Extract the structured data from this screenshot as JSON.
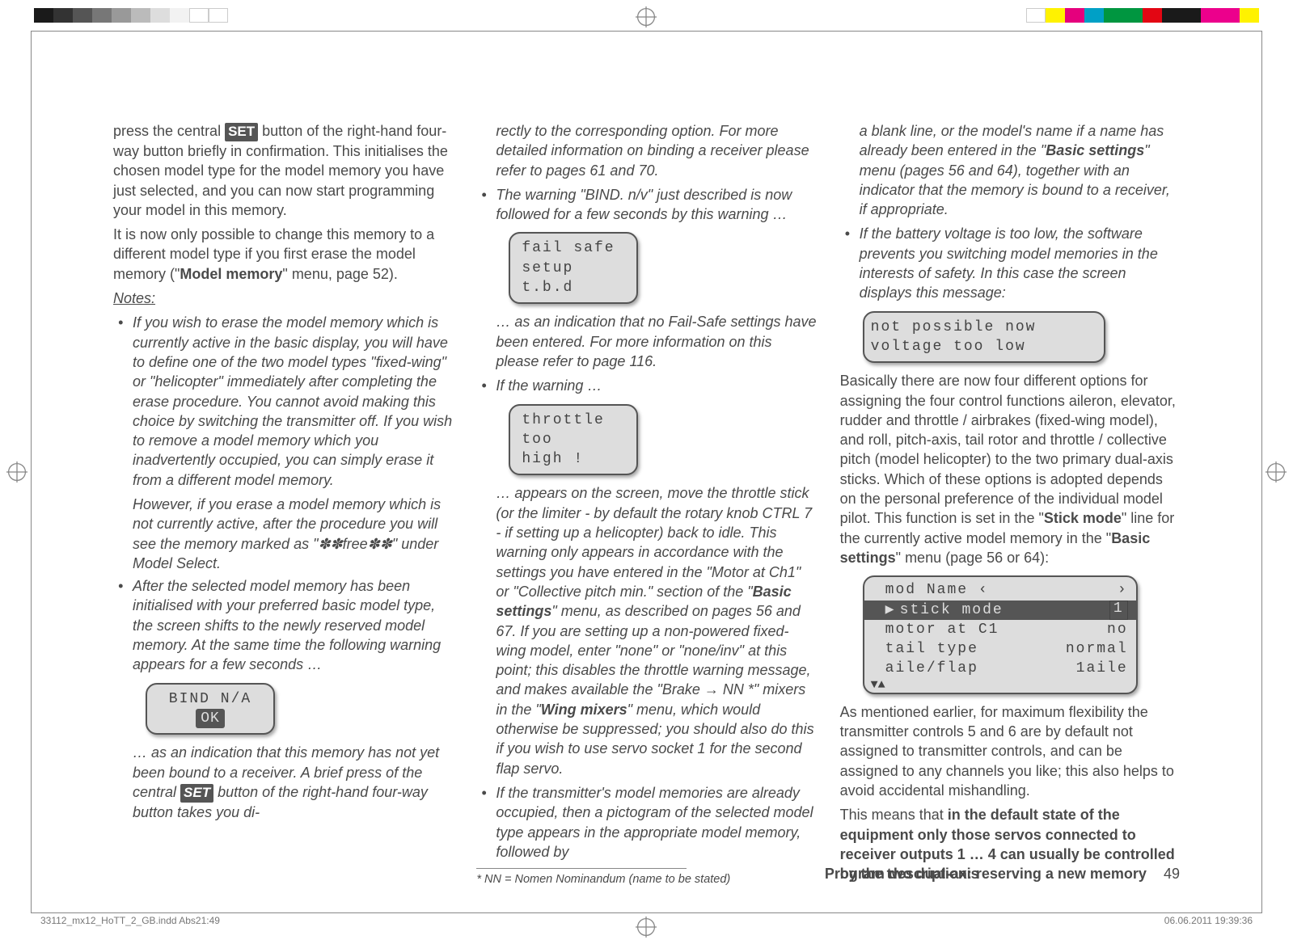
{
  "colorbars": {
    "left": [
      "#1a1a1a",
      "#333333",
      "#555555",
      "#777777",
      "#999999",
      "#bbbbbb",
      "#dddddd",
      "#f2f2f2",
      "#ffffff",
      "#ffffff"
    ],
    "right": [
      "#ffffff",
      "#fff200",
      "#e5007d",
      "#00a0c6",
      "#009640",
      "#009640",
      "#e30613",
      "#1a1a1a",
      "#1a1a1a",
      "#ec008c",
      "#ec008c",
      "#fff200"
    ]
  },
  "col1": {
    "p1a": "press the central ",
    "set": "SET",
    "p1b": " button of the right-hand four-way button briefly in confirmation. This initialises the chosen model type for the model memory you have just selected, and you can now start programming your model in this memory.",
    "p2a": "It is now only possible to change this memory to a different model type if you first erase the model memory (\"",
    "p2bold": "Model memory",
    "p2b": "\" menu, page 52).",
    "notes": "Notes:",
    "n1a": "If you wish to erase the model memory which is currently active in the basic display, you will have to define one of the two model types \"fixed-wing\" or \"helicopter\" immediately after completing the erase procedure. You cannot avoid making this choice by switching the transmitter off. If you wish to remove a model memory which you inadvertently occupied, you can simply erase it from a different model memory.",
    "n1b": "However, if you erase a model memory which is not currently active, after the procedure you will see the memory marked as \"✽✽free✽✽\" under Model Select.",
    "n2": "After the selected model memory has been initialised with your preferred basic model type, the screen shifts to the newly reserved model memory. At the same time the following warning appears for a few seconds …",
    "lcd_bind": "BIND N/A",
    "lcd_ok": "OK",
    "p3a": "… as an indication that this memory has not yet been bound to a receiver. A brief press of the central ",
    "p3b": " button of the right-hand four-way button takes you di-"
  },
  "col2": {
    "cont": "rectly to the corresponding option. For more detailed information on binding a receiver please refer to pages 61 and 70.",
    "b1": "The warning \"BIND. n/v\" just described is now followed for a few seconds by this warning …",
    "lcd_fs1": "fail safe",
    "lcd_fs2": "setup",
    "lcd_fs3": "t.b.d",
    "p_fs": "… as an indication that no Fail-Safe settings have been entered. For more information on this please refer to page 116.",
    "b2": "If the warning …",
    "lcd_th1": "throttle",
    "lcd_th2": "  too",
    "lcd_th3": "    high !",
    "p_th_a": "… appears on the screen, move the throttle stick (or the limiter - by default the rotary knob CTRL 7 - if setting up a helicopter) back to idle. This warning only appears in accordance with the settings you have entered in the \"Motor at Ch1\" or \"Collective pitch min.\" section of the \"",
    "p_th_bold1": "Basic settings",
    "p_th_b": "\" menu, as described on pages 56 and 67. If you are setting up a non-powered fixed-wing model, enter \"none\" or \"none/inv\" at this point; this disables the throttle warning message, and makes available the \"Brake ",
    "arrow": "→",
    "p_th_c": " NN *\" mixers in the \"",
    "p_th_bold2": "Wing mixers",
    "p_th_d": "\" menu, which would otherwise be suppressed; you should also do this if you wish to use servo socket 1 for the second flap servo.",
    "b3": "If the transmitter's model memories are already occupied, then a pictogram of the selected model type appears in the appropriate model memory, followed by",
    "fn": "*    NN = Nomen Nominandum (name to be stated)"
  },
  "col3": {
    "cont_a": "a blank line, or the model's name if a name has already been entered in the \"",
    "cont_bold": "Basic settings",
    "cont_b": "\" menu (pages 56 and 64), together with an indicator that the memory is bound to a receiver, if appropriate.",
    "b1": "If the battery voltage is too low, the software prevents you switching model memories in the interests of safety. In this case the screen displays this message:",
    "lcd_v1": "not possible now",
    "lcd_v2": "voltage too low",
    "p2a": "Basically there are now four different options for assigning the four control functions aileron, elevator, rudder and throttle / airbrakes (fixed-wing model), and roll, pitch-axis, tail rotor and throttle / collective pitch (model helicopter) to the two primary dual-axis sticks. Which of these options is adopted depends on the personal preference of the individual model pilot. This function is set in the \"",
    "p2bold1": "Stick mode",
    "p2b": "\" line for the currently active model memory in the \"",
    "p2bold2": "Basic settings",
    "p2c": "\" menu (page 56 or 64):",
    "settings": {
      "row1_l": "mod Name ‹",
      "row1_r": "›",
      "row2_l": "stick mode",
      "row2_r": "1",
      "row3_l": "motor at C1",
      "row3_r": "no",
      "row4_l": "tail type",
      "row4_r": "normal",
      "row5_l": "aile/flap",
      "row5_r": "1aile"
    },
    "p3": "As mentioned earlier, for maximum flexibility the transmitter controls 5 and 6 are by default not assigned to transmitter controls, and can be assigned to any channels you like; this also helps to avoid accidental mishandling.",
    "p4a": "This means that ",
    "p4bold": "in the default state of the equipment only those servos connected to receiver outputs 1 … 4 can usually be controlled by the two dual-axis"
  },
  "footer": {
    "title": "Program description: reserving a new memory",
    "page": "49"
  },
  "print": {
    "left": "33112_mx12_HoTT_2_GB.indd   Abs21:49",
    "right": "06.06.2011   19:39:36"
  }
}
